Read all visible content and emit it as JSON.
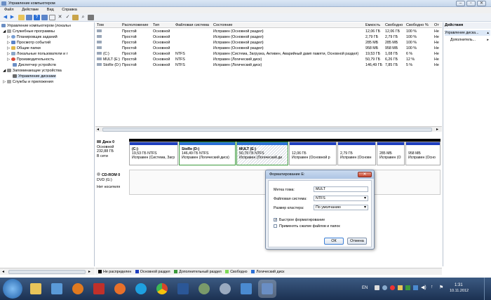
{
  "window": {
    "title": "Управление компьютером"
  },
  "menu": [
    "Файл",
    "Действие",
    "Вид",
    "Справка"
  ],
  "tree": [
    {
      "label": "Управление компьютером (локальн",
      "level": 0
    },
    {
      "label": "Служебные программы",
      "level": 1
    },
    {
      "label": "Планировщик заданий",
      "level": 2
    },
    {
      "label": "Просмотр событий",
      "level": 2
    },
    {
      "label": "Общие папки",
      "level": 2
    },
    {
      "label": "Локальные пользователи и г",
      "level": 2
    },
    {
      "label": "Производительность",
      "level": 2
    },
    {
      "label": "Диспетчер устройств",
      "level": 2
    },
    {
      "label": "Запоминающие устройства",
      "level": 1
    },
    {
      "label": "Управление дисками",
      "level": 2
    },
    {
      "label": "Службы и приложения",
      "level": 1
    }
  ],
  "volumes": {
    "columns": [
      "Том",
      "Расположение",
      "Тип",
      "Файловая система",
      "Состояние",
      "Емкость",
      "Свободно",
      "Свободно %",
      "От"
    ],
    "rows": [
      [
        "",
        "Простой",
        "Основной",
        "",
        "Исправен (Основной раздел)",
        "12,06 ГБ",
        "12,06 ГБ",
        "100 %",
        "Не"
      ],
      [
        "",
        "Простой",
        "Основной",
        "",
        "Исправен (Основной раздел)",
        "2,79 ГБ",
        "2,79 ГБ",
        "100 %",
        "Не"
      ],
      [
        "",
        "Простой",
        "Основной",
        "",
        "Исправен (Основной раздел)",
        "285 МБ",
        "285 МБ",
        "100 %",
        "Не"
      ],
      [
        "",
        "Простой",
        "Основной",
        "",
        "Исправен (Основной раздел)",
        "958 МБ",
        "958 МБ",
        "100 %",
        "Не"
      ],
      [
        "(C:)",
        "Простой",
        "Основной",
        "NTFS",
        "Исправен (Система, Загрузка, Активен, Аварийный дамп памяти, Основной раздел)",
        "19,53 ГБ",
        "1,08 ГБ",
        "6 %",
        "Не"
      ],
      [
        "MULT (E:)",
        "Простой",
        "Основной",
        "NTFS",
        "Исправен (Логический диск)",
        "50,79 ГБ",
        "6,26 ГБ",
        "12 %",
        "Не"
      ],
      [
        "StoRe (D:)",
        "Простой",
        "Основной",
        "NTFS",
        "Исправен (Логический диск)",
        "146,49 ГБ",
        "7,85 ГБ",
        "5 %",
        "Не"
      ]
    ]
  },
  "disk0": {
    "name": "Диск 0",
    "type": "Основной",
    "size": "232,88 ГБ",
    "status": "В сети",
    "partitions": [
      {
        "title": "(C:)",
        "line2": "19,53 ГБ NTFS",
        "line3": "Исправен (Система, Загр"
      },
      {
        "title": "StoRe (D:)",
        "line2": "146,49 ГБ NTFS",
        "line3": "Исправен (Логический диск)"
      },
      {
        "title": "MULT (E:)",
        "line2": "50,79 ГБ NTFS",
        "line3": "Исправен (Логический ди"
      },
      {
        "title": "",
        "line2": "12,06 ГБ",
        "line3": "Исправен (Основной р"
      },
      {
        "title": "",
        "line2": "2,79 ГБ",
        "line3": "Исправен (Основн"
      },
      {
        "title": "",
        "line2": "285 МБ",
        "line3": "Исправен (О"
      },
      {
        "title": "",
        "line2": "958 МБ",
        "line3": "Исправен (Осно"
      }
    ]
  },
  "cdrom0": {
    "name": "CD-ROM 0",
    "type": "DVD (G:)",
    "status": "Нет носителя"
  },
  "actions": {
    "title": "Действия",
    "items": [
      "Управление диска...",
      "Дополнитель..."
    ]
  },
  "legend": [
    {
      "label": "Не распределен",
      "color": "#000000"
    },
    {
      "label": "Основной раздел",
      "color": "#1f3fbf"
    },
    {
      "label": "Дополнительный раздел",
      "color": "#3c9a3c"
    },
    {
      "label": "Свободно",
      "color": "#7ed957"
    },
    {
      "label": "Логический диск",
      "color": "#2a6fd6"
    }
  ],
  "dialog": {
    "title": "Форматирование E:",
    "label_volume": "Метка тома:",
    "value_volume": "MULT",
    "label_fs": "Файловая система:",
    "value_fs": "NTFS",
    "label_cluster": "Размер кластера:",
    "value_cluster": "По умолчанию",
    "quick_format": "Быстрое форматирование",
    "compression": "Применять сжатие файлов и папок",
    "ok": "ОК",
    "cancel": "Отмена"
  },
  "tray": {
    "lang": "EN",
    "time": "1:31",
    "date": "10.11.2012"
  }
}
